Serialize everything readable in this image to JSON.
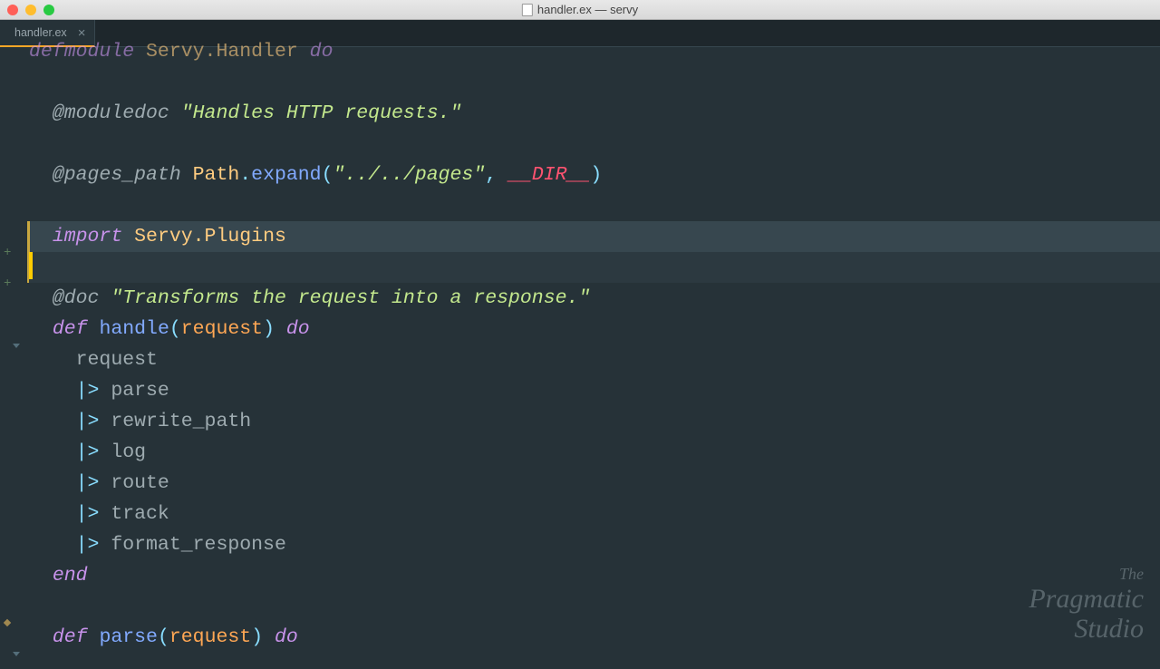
{
  "window": {
    "title": "handler.ex — servy"
  },
  "tab": {
    "name": "handler.ex"
  },
  "code": {
    "l1a": "defmodule",
    "l1b": "Servy.Handler",
    "l1c": "do",
    "l3a": "@moduledoc",
    "l3b": "\"Handles HTTP requests.\"",
    "l5a": "@pages_path",
    "l5b": "Path",
    "l5c": ".",
    "l5d": "expand",
    "l5e": "(",
    "l5f": "\"../../pages\"",
    "l5g": ", ",
    "l5h": "__DIR__",
    "l5i": ")",
    "l7a": "import",
    "l7b": "Servy.Plugins",
    "l9a": "@doc",
    "l9b": "\"Transforms the request into a response.\"",
    "l10a": "def",
    "l10b": "handle",
    "l10c": "(",
    "l10d": "request",
    "l10e": ") ",
    "l10f": "do",
    "l11": "    request",
    "l12a": "    |> ",
    "l12b": "parse",
    "l13a": "    |> ",
    "l13b": "rewrite_path",
    "l14a": "    |> ",
    "l14b": "log",
    "l15a": "    |> ",
    "l15b": "route",
    "l16a": "    |> ",
    "l16b": "track",
    "l17a": "    |> ",
    "l17b": "format_response",
    "l18": "end",
    "l20a": "def",
    "l20b": "parse",
    "l20c": "(",
    "l20d": "request",
    "l20e": ") ",
    "l20f": "do"
  },
  "watermark": {
    "line1": "The",
    "line2": "Pragmatic",
    "line3": "Studio"
  }
}
